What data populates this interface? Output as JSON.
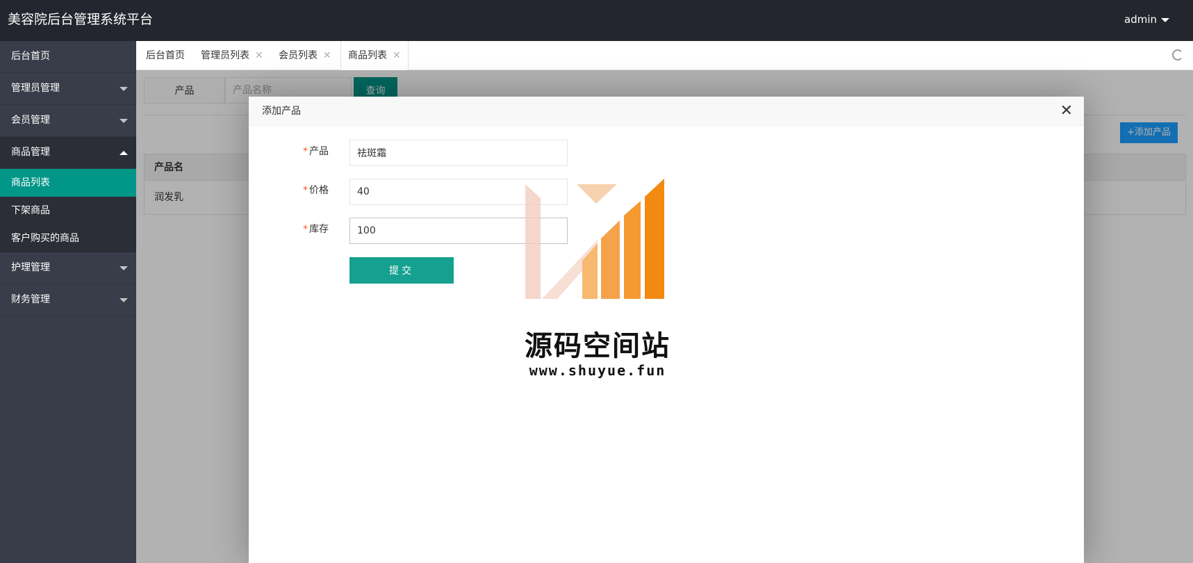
{
  "header": {
    "app_title": "美容院后台管理系统平台",
    "user": "admin"
  },
  "sidebar": {
    "items": [
      {
        "label": "后台首页"
      },
      {
        "label": "管理员管理"
      },
      {
        "label": "会员管理"
      },
      {
        "label": "商品管理",
        "children": [
          "商品列表",
          "下架商品",
          "客户购买的商品"
        ]
      },
      {
        "label": "护理管理"
      },
      {
        "label": "财务管理"
      }
    ]
  },
  "tabs": [
    {
      "label": "后台首页"
    },
    {
      "label": "管理员列表"
    },
    {
      "label": "会员列表"
    },
    {
      "label": "商品列表"
    }
  ],
  "tab_close_glyph": "✕",
  "search": {
    "label": "产品",
    "placeholder": "产品名称",
    "button": "查询"
  },
  "add_button": "+添加产品",
  "table": {
    "header": "产品名",
    "rows": [
      "润发乳"
    ]
  },
  "dialog": {
    "title": "添加产品",
    "close_glyph": "✕",
    "required_mark": "*",
    "fields": [
      {
        "label": "产品",
        "value": "祛斑霜"
      },
      {
        "label": "价格",
        "value": "40"
      },
      {
        "label": "库存",
        "value": "100"
      }
    ],
    "submit": "提交"
  },
  "watermark": {
    "text": "源码空间站",
    "url": "www.shuyue.fun"
  }
}
